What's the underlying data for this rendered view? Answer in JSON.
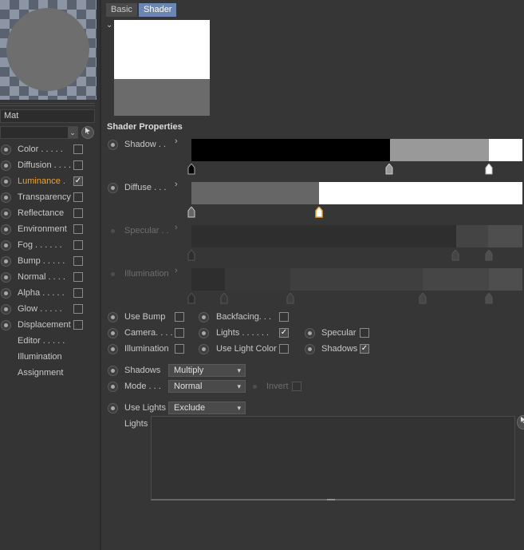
{
  "material": {
    "name": "Mat"
  },
  "channels": [
    {
      "label": "Color . . . . .",
      "checked": false,
      "active": false
    },
    {
      "label": "Diffusion . . . .",
      "checked": false,
      "active": false
    },
    {
      "label": "Luminance  .",
      "checked": true,
      "active": true
    },
    {
      "label": "Transparency",
      "checked": false,
      "active": false
    },
    {
      "label": "Reflectance",
      "checked": false,
      "active": false
    },
    {
      "label": "Environment",
      "checked": false,
      "active": false
    },
    {
      "label": "Fog  . . . . . .",
      "checked": false,
      "active": false
    },
    {
      "label": "Bump . . . . .",
      "checked": false,
      "active": false
    },
    {
      "label": "Normal . . . .",
      "checked": false,
      "active": false
    },
    {
      "label": "Alpha . . . . .",
      "checked": false,
      "active": false
    },
    {
      "label": "Glow . . . . .",
      "checked": false,
      "active": false
    },
    {
      "label": "Displacement",
      "checked": false,
      "active": false
    }
  ],
  "extras": [
    "Editor . . . . .",
    "Illumination",
    "Assignment"
  ],
  "tabs": {
    "basic": "Basic",
    "shader": "Shader"
  },
  "section_title": "Shader Properties",
  "gradients": {
    "shadow": {
      "label": "Shadow  . .",
      "enabled": true
    },
    "diffuse": {
      "label": "Diffuse  . . .",
      "enabled": true
    },
    "specular": {
      "label": "Specular . .",
      "enabled": false
    },
    "illumination": {
      "label": "Illumination",
      "enabled": false
    }
  },
  "options": {
    "use_bump": {
      "label": "Use Bump",
      "checked": false
    },
    "backfacing": {
      "label": "Backfacing. . .",
      "checked": false
    },
    "camera": {
      "label": "Camera. . . .",
      "checked": false
    },
    "lights": {
      "label": "Lights . . . . . .",
      "checked": true
    },
    "specular": {
      "label": "Specular",
      "checked": false
    },
    "illumination": {
      "label": "Illumination",
      "checked": false
    },
    "use_light_color": {
      "label": "Use Light Color",
      "checked": false
    },
    "shadows": {
      "label": "Shadows",
      "checked": true
    }
  },
  "shadows_mode": {
    "label": "Shadows",
    "value": "Multiply"
  },
  "blend_mode": {
    "label": "Mode . . .",
    "value": "Normal"
  },
  "invert": {
    "label": "Invert",
    "checked": false
  },
  "use_lights": {
    "label": "Use Lights",
    "value": "Exclude"
  },
  "lights_list": {
    "label": "Lights"
  },
  "icons": {
    "check": "✓",
    "chevron_down": "⌄",
    "chevron_right": "›",
    "cursor": "cursor-icon"
  },
  "colors": {
    "accent_orange": "#f0a030",
    "tab_active": "#6c86b4"
  }
}
